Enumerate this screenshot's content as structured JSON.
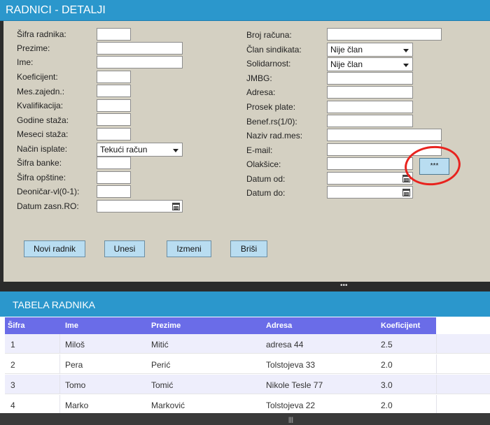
{
  "panel_top": {
    "title": "RADNICI - DETALJI"
  },
  "form_left": [
    {
      "label": "Šifra radnika:",
      "kind": "input"
    },
    {
      "label": "Prezime:",
      "kind": "input"
    },
    {
      "label": "Ime:",
      "kind": "input"
    },
    {
      "label": "Koeficijent:",
      "kind": "input"
    },
    {
      "label": "Mes.zajedn.:",
      "kind": "input"
    },
    {
      "label": "Kvalifikacija:",
      "kind": "input"
    },
    {
      "label": "Godine staža:",
      "kind": "input"
    },
    {
      "label": "Meseci staža:",
      "kind": "input"
    },
    {
      "label": "Način isplate:",
      "kind": "select",
      "value": "Tekući račun"
    },
    {
      "label": "Šifra banke:",
      "kind": "input"
    },
    {
      "label": "Šifra opštine:",
      "kind": "input"
    },
    {
      "label": "Deoničar-vl(0-1):",
      "kind": "input"
    },
    {
      "label": "Datum zasn.RO:",
      "kind": "date"
    }
  ],
  "form_right": [
    {
      "label": "Broj računa:",
      "kind": "input"
    },
    {
      "label": "Član sindikata:",
      "kind": "select",
      "value": "Nije član"
    },
    {
      "label": "Solidarnost:",
      "kind": "select",
      "value": "Nije član"
    },
    {
      "label": "JMBG:",
      "kind": "input"
    },
    {
      "label": "Adresa:",
      "kind": "input"
    },
    {
      "label": "Prosek plate:",
      "kind": "input"
    },
    {
      "label": "Benef.rs(1/0):",
      "kind": "input"
    },
    {
      "label": "Naziv rad.mes:",
      "kind": "input"
    },
    {
      "label": "E-mail:",
      "kind": "input"
    },
    {
      "label": "Olakšice:",
      "kind": "input"
    },
    {
      "label": "Datum od:",
      "kind": "date"
    },
    {
      "label": "Datum do:",
      "kind": "date"
    }
  ],
  "olaksice_button": "***",
  "actions": {
    "new": "Novi radnik",
    "save": "Unesi",
    "edit": "Izmeni",
    "delete": "Briši"
  },
  "panel_bottom": {
    "title": "TABELA RADNIKA"
  },
  "table": {
    "columns": [
      "Šifra",
      "Ime",
      "Prezime",
      "Adresa",
      "Koeficijent"
    ],
    "rows": [
      [
        "1",
        "Miloš",
        "Mitić",
        "adresa 44",
        "2.5"
      ],
      [
        "2",
        "Pera",
        "Perić",
        "Tolstojeva 33",
        "2.0"
      ],
      [
        "3",
        "Tomo",
        "Tomić",
        "Nikole Tesle 77",
        "3.0"
      ],
      [
        "4",
        "Marko",
        "Marković",
        "Tolstojeva 22",
        "2.0"
      ]
    ]
  },
  "colors": {
    "title_bar": "#2b97cc",
    "panel_bg": "#d4d0c2",
    "button_bg": "#b9ddf1",
    "table_header": "#6a6ce8",
    "annotation": "#e8231e"
  }
}
